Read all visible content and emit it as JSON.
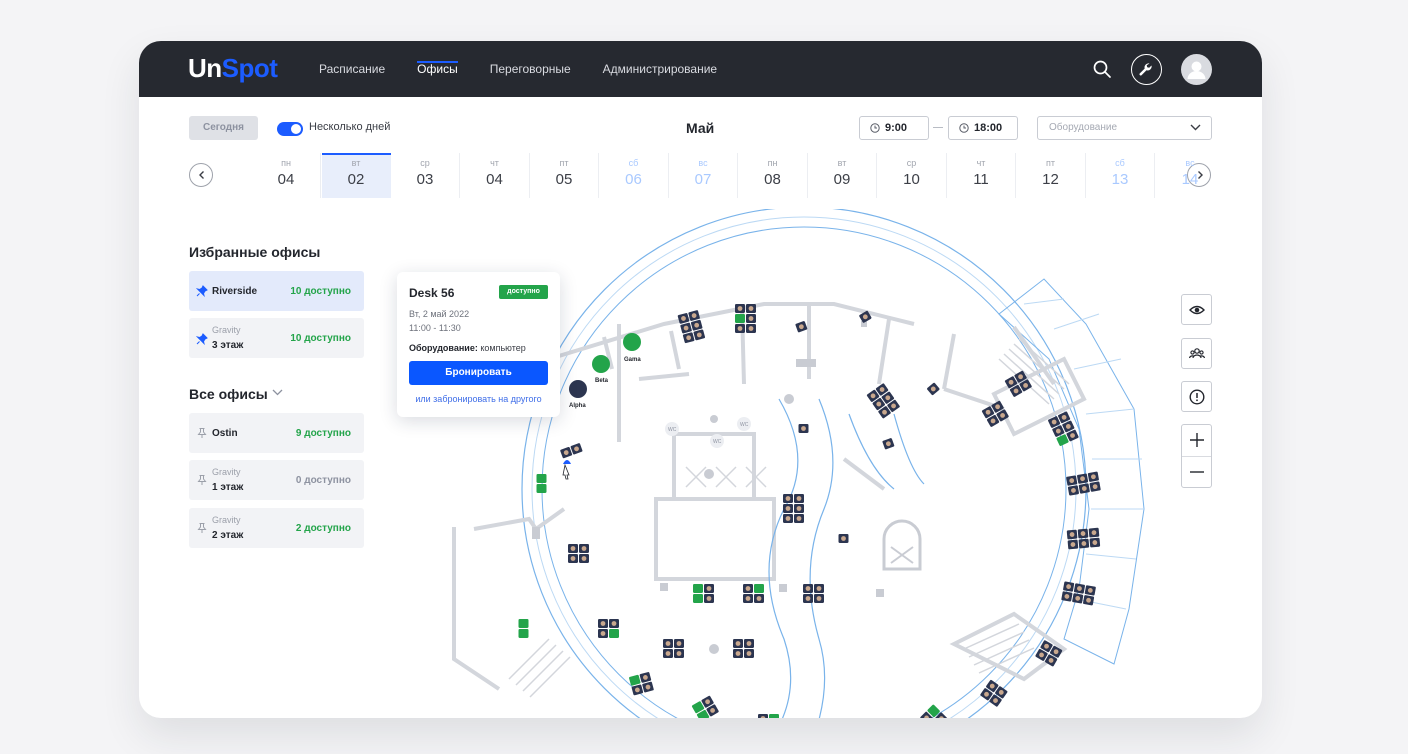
{
  "header": {
    "logo_part1": "Un",
    "logo_part2": "Spot",
    "nav": [
      "Расписание",
      "Офисы",
      "Переговорные",
      "Администрирование"
    ],
    "active_nav": "Офисы",
    "icons": [
      "search-icon",
      "wrench-icon",
      "user-avatar-icon"
    ]
  },
  "toolbar": {
    "today_label": "Сегодня",
    "multi_day_label": "Несколько дней",
    "multi_day_enabled": true,
    "month": "Май",
    "time_from": "9:00",
    "time_to": "18:00",
    "equipment_placeholder": "Оборудование"
  },
  "calendar": {
    "days": [
      {
        "dow": "пн",
        "date": "04",
        "weekend": false,
        "selected": false
      },
      {
        "dow": "вт",
        "date": "02",
        "weekend": false,
        "selected": true
      },
      {
        "dow": "ср",
        "date": "03",
        "weekend": false,
        "selected": false
      },
      {
        "dow": "чт",
        "date": "04",
        "weekend": false,
        "selected": false
      },
      {
        "dow": "пт",
        "date": "05",
        "weekend": false,
        "selected": false
      },
      {
        "dow": "сб",
        "date": "06",
        "weekend": true,
        "selected": false
      },
      {
        "dow": "вс",
        "date": "07",
        "weekend": true,
        "selected": false
      },
      {
        "dow": "пн",
        "date": "08",
        "weekend": false,
        "selected": false
      },
      {
        "dow": "вт",
        "date": "09",
        "weekend": false,
        "selected": false
      },
      {
        "dow": "ср",
        "date": "10",
        "weekend": false,
        "selected": false
      },
      {
        "dow": "чт",
        "date": "11",
        "weekend": false,
        "selected": false
      },
      {
        "dow": "пт",
        "date": "12",
        "weekend": false,
        "selected": false
      },
      {
        "dow": "сб",
        "date": "13",
        "weekend": true,
        "selected": false
      },
      {
        "dow": "вс",
        "date": "14",
        "weekend": true,
        "selected": false
      }
    ]
  },
  "favorites": {
    "title": "Избранные офисы",
    "items": [
      {
        "sub": "",
        "name": "Riverside",
        "count": "10 доступно",
        "active": true
      },
      {
        "sub": "Gravity",
        "name": "3 этаж",
        "count": "10 доступно",
        "active": false
      }
    ]
  },
  "all_offices": {
    "title": "Все офисы",
    "items": [
      {
        "sub": "",
        "name": "Ostin",
        "count": "9 доступно",
        "grey": false
      },
      {
        "sub": "Gravity",
        "name": "1 этаж",
        "count": "0 доступно",
        "grey": true
      },
      {
        "sub": "Gravity",
        "name": "2 этаж",
        "count": "2 доступно",
        "grey": false
      }
    ]
  },
  "map": {
    "rooms": [
      "Gama",
      "Beta",
      "Alpha"
    ],
    "wc_labels": [
      "WC",
      "WC",
      "WC"
    ]
  },
  "popup": {
    "title": "Desk 56",
    "status": "доступно",
    "date": "Вт, 2 май 2022",
    "time": "11:00 - 11:30",
    "equipment_label": "Оборудование:",
    "equipment_value": "компьютер",
    "book_label": "Бронировать",
    "other_label": "или забронировать на другого"
  },
  "map_controls": [
    "eye-icon",
    "group-icon",
    "alert-icon",
    "zoom-in-icon",
    "zoom-out-icon"
  ],
  "colors": {
    "accent": "#1c5cff",
    "available": "#23a44a",
    "desk": "#2c3550",
    "topbar": "#262930"
  }
}
